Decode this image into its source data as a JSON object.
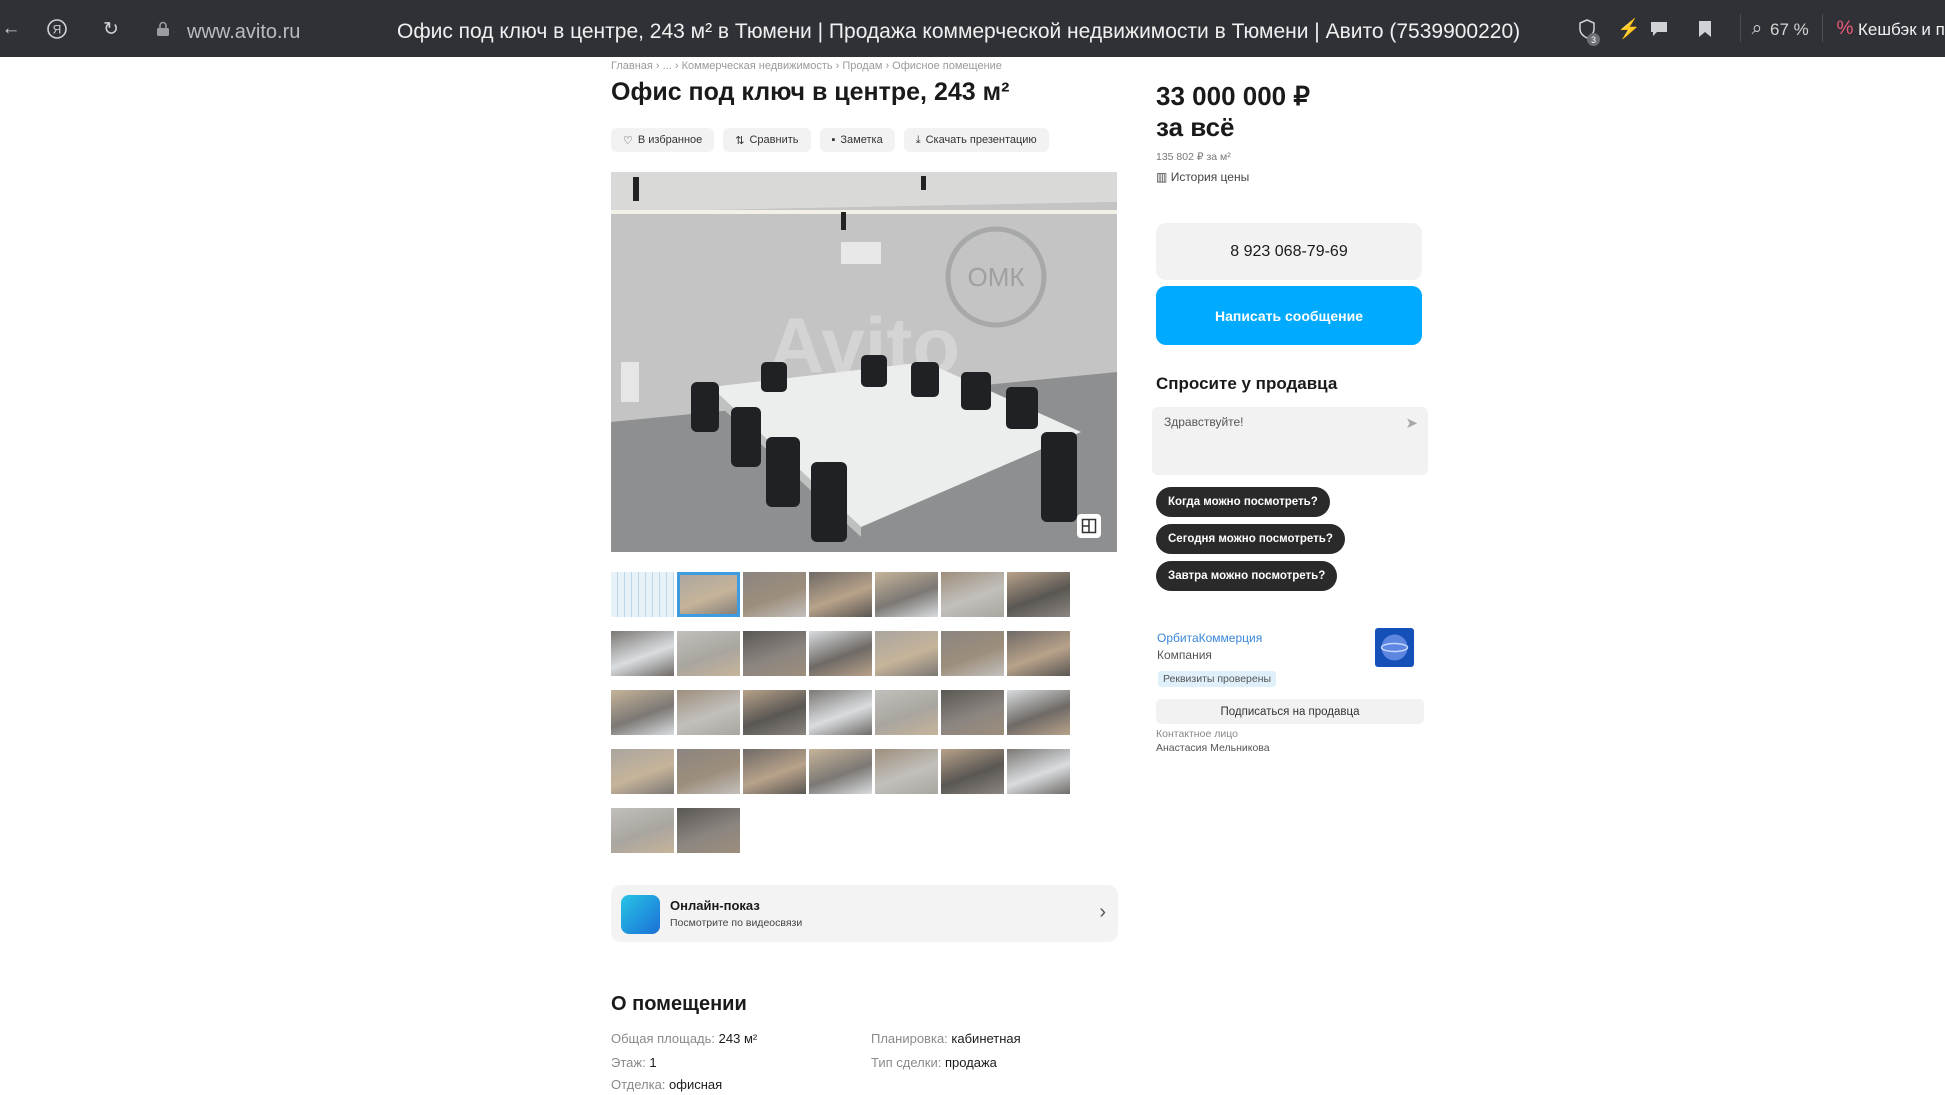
{
  "browser": {
    "url": "www.avito.ru",
    "tab_title": "Офис под ключ в центре, 243 м² в Тюмени | Продажа коммерческой недвижимости в Тюмени | Авито (7539900220)",
    "zoom": "67 %",
    "cashback": "Кешбэк и пр",
    "notif_count": "3"
  },
  "breadcrumb": [
    "Главная",
    "...",
    "Коммерческая недвижимость",
    "Продам",
    "Офисное помещение"
  ],
  "title": "Офис под ключ в центре, 243 м²",
  "actions": {
    "favorite": "В избранное",
    "compare": "Сравнить",
    "note": "Заметка",
    "download": "Скачать презентацию"
  },
  "photo": {
    "watermark": "Avito",
    "logo": "ОМК"
  },
  "online_show": {
    "title": "Онлайн-показ",
    "subtitle": "Посмотрите по видеосвязи"
  },
  "about": {
    "title": "О помещении",
    "specs": [
      {
        "k": "Общая площадь:",
        "v": "243 м²"
      },
      {
        "k": "Планировка:",
        "v": "кабинетная"
      },
      {
        "k": "Этаж:",
        "v": "1"
      },
      {
        "k": "Тип сделки:",
        "v": "продажа"
      },
      {
        "k": "Отделка:",
        "v": "офисная"
      }
    ]
  },
  "price": {
    "value": "33 000 000 ₽",
    "suffix": "за всё",
    "per_m2": "135 802 ₽ за м²",
    "history": "История цены"
  },
  "contact": {
    "phone": "8 923 068-79-69",
    "message_button": "Написать сообщение"
  },
  "ask": {
    "title": "Спросите у продавца",
    "placeholder": "Здравствуйте!",
    "questions": [
      "Когда можно посмотреть?",
      "Сегодня можно посмотреть?",
      "Завтра можно посмотреть?"
    ]
  },
  "seller": {
    "name": "ОрбитаКоммерция",
    "type": "Компания",
    "verified": "Реквизиты проверены",
    "subscribe": "Подписаться на продавца",
    "contact_label": "Контактное лицо",
    "contact_name": "Анастасия Мельникова"
  },
  "colors": {
    "accent": "#00aaff",
    "chip": "#2a2a2a",
    "browser_bar": "#2f3136"
  }
}
